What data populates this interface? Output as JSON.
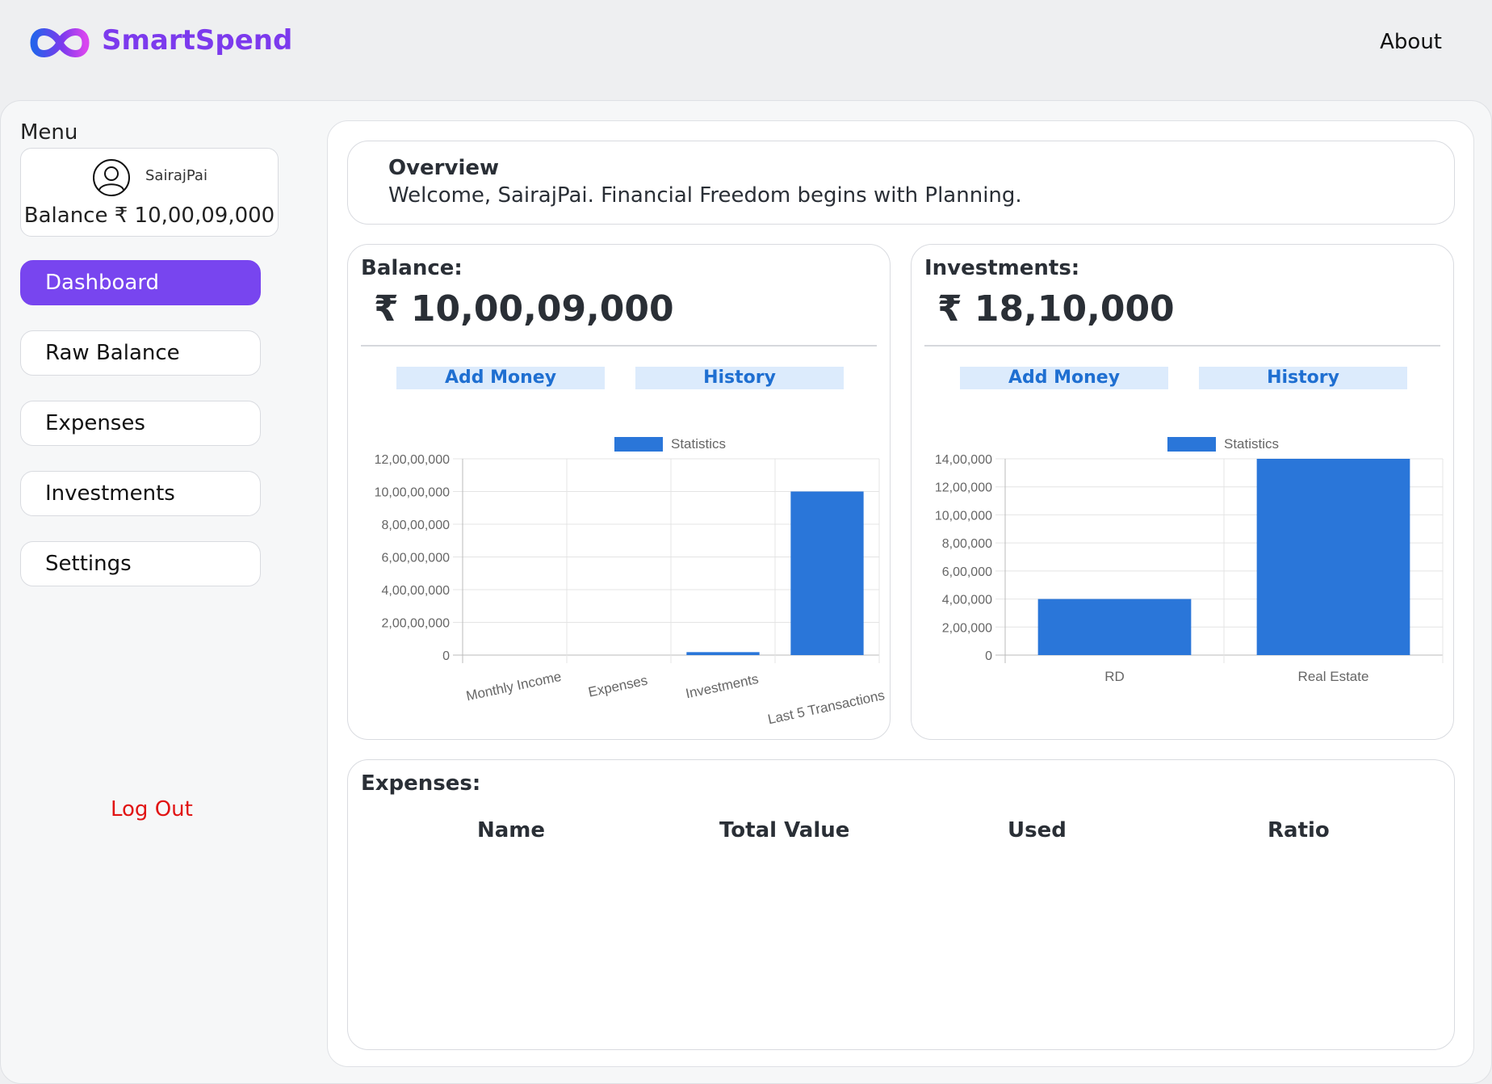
{
  "header": {
    "brand": "SmartSpend",
    "about_link": "About",
    "colors": {
      "brand": "#7c3aed",
      "logo_start": "#2563eb",
      "logo_end": "#d946ef"
    }
  },
  "sidebar": {
    "menu_title": "Menu",
    "user": {
      "name": "SairajPai",
      "balance_text": "Balance ₹ 10,00,09,000",
      "icon": "user-circle-icon"
    },
    "items": [
      {
        "label": "Dashboard",
        "active": true
      },
      {
        "label": "Raw Balance",
        "active": false
      },
      {
        "label": "Expenses",
        "active": false
      },
      {
        "label": "Investments",
        "active": false
      },
      {
        "label": "Settings",
        "active": false
      }
    ],
    "logout": "Log Out",
    "colors": {
      "active_item": "#7845ef",
      "logout": "#e11414"
    }
  },
  "overview": {
    "title": "Overview",
    "subtitle": "Welcome, SairajPai. Financial Freedom begins with Planning."
  },
  "balance_card": {
    "title": "Balance:",
    "amount": "₹ 10,00,09,000",
    "add_money": "Add Money",
    "history": "History"
  },
  "investments_card": {
    "title": "Investments:",
    "amount": "₹ 18,10,000",
    "add_money": "Add Money",
    "history": "History"
  },
  "expenses_card": {
    "title": "Expenses:",
    "columns": [
      "Name",
      "Total Value",
      "Used",
      "Ratio"
    ]
  },
  "chart_data": [
    {
      "type": "bar",
      "legend": [
        "Statistics"
      ],
      "legend_position": "top",
      "categories": [
        "Monthly Income",
        "Expenses",
        "Investments",
        "Last 5 Transactions"
      ],
      "series": [
        {
          "name": "Statistics",
          "values": [
            0,
            0,
            1810000,
            100009000
          ]
        }
      ],
      "ylim": [
        0,
        120000000
      ],
      "yticks": [
        "0",
        "2,00,00,000",
        "4,00,00,000",
        "6,00,00,000",
        "8,00,00,000",
        "10,00,00,000",
        "12,00,00,000"
      ],
      "ytick_values": [
        0,
        20000000,
        40000000,
        60000000,
        80000000,
        100000000,
        120000000
      ],
      "grid": true,
      "bar_color": "#2a76d9"
    },
    {
      "type": "bar",
      "legend": [
        "Statistics"
      ],
      "legend_position": "top",
      "categories": [
        "RD",
        "Real Estate"
      ],
      "series": [
        {
          "name": "Statistics",
          "values": [
            400000,
            1400000
          ]
        }
      ],
      "ylim": [
        0,
        1400000
      ],
      "yticks": [
        "0",
        "2,00,000",
        "4,00,000",
        "6,00,000",
        "8,00,000",
        "10,00,000",
        "12,00,000",
        "14,00,000"
      ],
      "ytick_values": [
        0,
        200000,
        400000,
        600000,
        800000,
        1000000,
        1200000,
        1400000
      ],
      "grid": true,
      "bar_color": "#2a76d9"
    }
  ]
}
